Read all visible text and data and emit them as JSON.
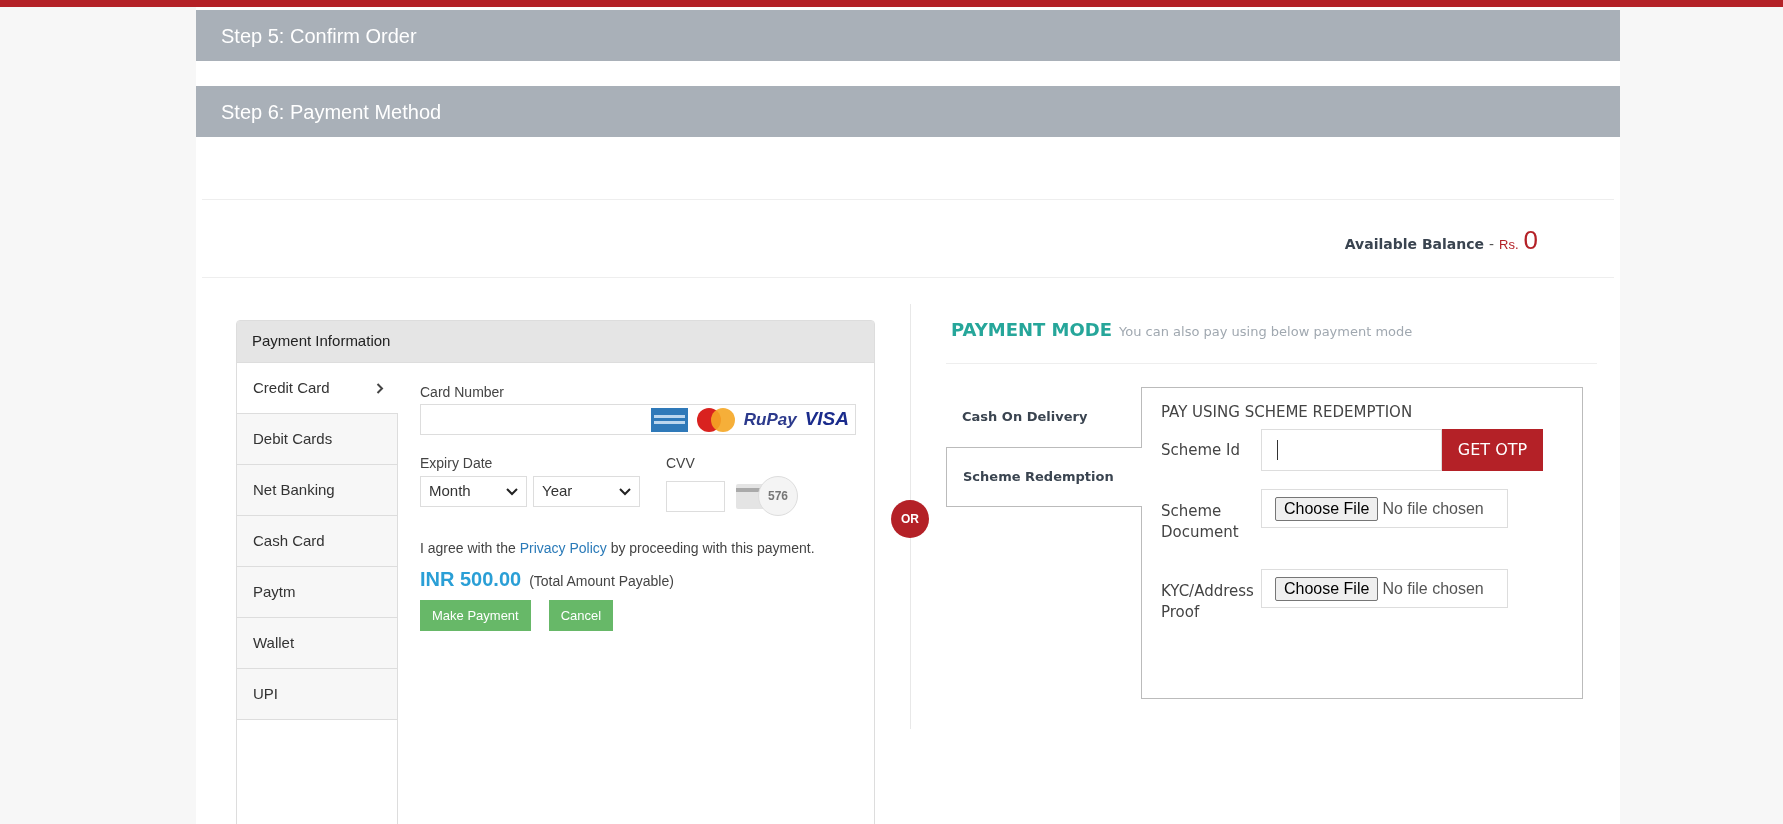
{
  "steps": [
    {
      "title": "Step 5: Confirm Order"
    },
    {
      "title": "Step 6: Payment Method"
    }
  ],
  "balance": {
    "label": "Available Balance",
    "separator": "-",
    "currency": "Rs.",
    "amount": "0"
  },
  "payment_information": {
    "title": "Payment Information",
    "methods": [
      {
        "label": "Credit Card",
        "selected": true
      },
      {
        "label": "Debit Cards",
        "selected": false
      },
      {
        "label": "Net Banking",
        "selected": false
      },
      {
        "label": "Cash Card",
        "selected": false
      },
      {
        "label": "Paytm",
        "selected": false
      },
      {
        "label": "Wallet",
        "selected": false
      },
      {
        "label": "UPI",
        "selected": false
      }
    ],
    "card_number_label": "Card Number",
    "card_brands": [
      "RuPay",
      "VISA"
    ],
    "expiry_label": "Expiry Date",
    "month_select": "Month",
    "year_select": "Year",
    "cvv_label": "CVV",
    "cvv_sample": "576",
    "agreement": {
      "before": "I agree with the",
      "link": "Privacy Policy",
      "after": "by proceeding with this payment."
    },
    "amount": "INR 500.00",
    "amount_note": "(Total Amount Payable)",
    "buttons": [
      "Make Payment",
      "Cancel"
    ]
  },
  "or_badge": "OR",
  "payment_mode": {
    "title": "PAYMENT MODE",
    "subtitle": "You can also pay using below payment mode",
    "tabs": [
      {
        "label": "Cash On Delivery",
        "selected": false
      },
      {
        "label": "Scheme Redemption",
        "selected": true
      }
    ],
    "panel_title": "PAY USING SCHEME REDEMPTION",
    "scheme_id_label": "Scheme Id",
    "otp_button": "GET OTP",
    "uploads": [
      {
        "label": "Scheme Document",
        "button": "Choose File",
        "status": "No file chosen"
      },
      {
        "label": "KYC/Address Proof",
        "button": "Choose File",
        "status": "No file chosen"
      }
    ]
  }
}
